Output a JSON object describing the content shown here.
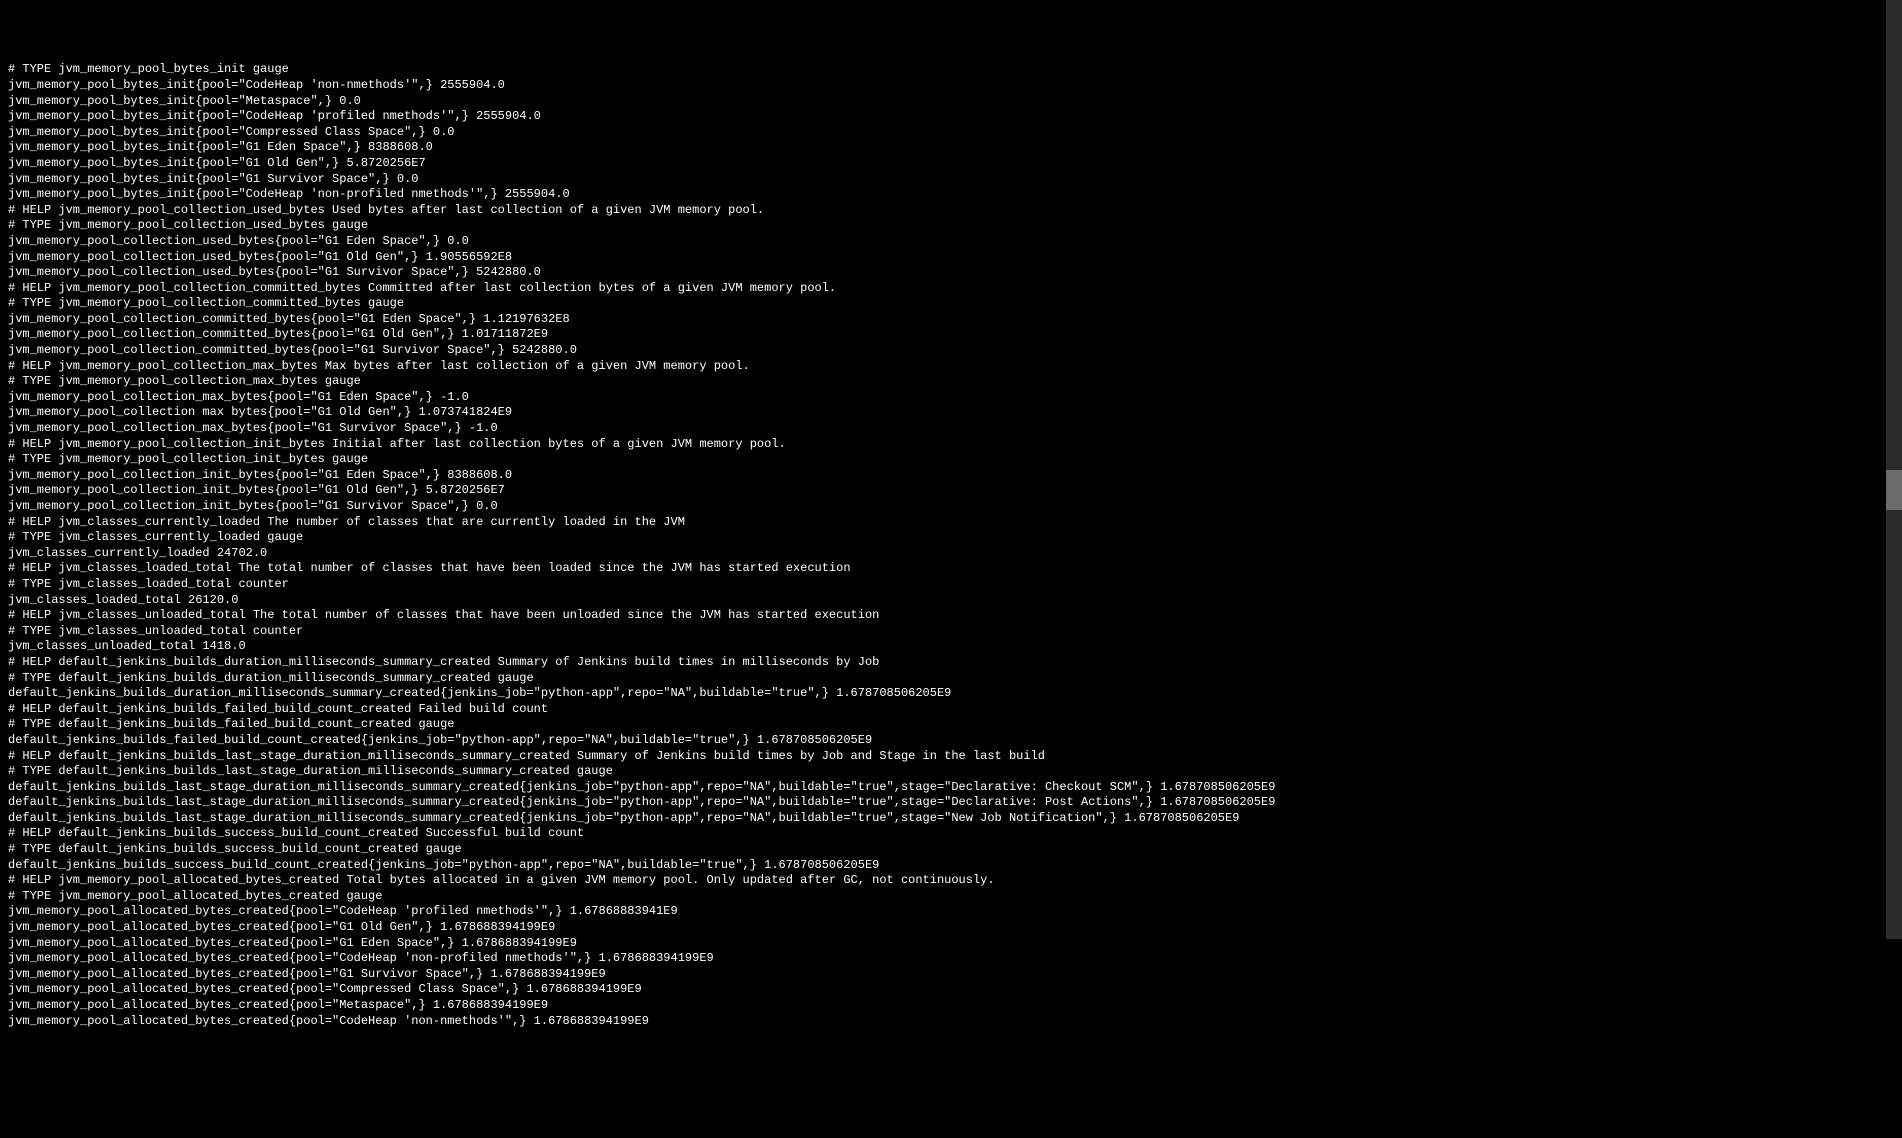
{
  "lines": [
    "# TYPE jvm_memory_pool_bytes_init gauge",
    "jvm_memory_pool_bytes_init{pool=\"CodeHeap 'non-nmethods'\",} 2555904.0",
    "jvm_memory_pool_bytes_init{pool=\"Metaspace\",} 0.0",
    "jvm_memory_pool_bytes_init{pool=\"CodeHeap 'profiled nmethods'\",} 2555904.0",
    "jvm_memory_pool_bytes_init{pool=\"Compressed Class Space\",} 0.0",
    "jvm_memory_pool_bytes_init{pool=\"G1 Eden Space\",} 8388608.0",
    "jvm_memory_pool_bytes_init{pool=\"G1 Old Gen\",} 5.8720256E7",
    "jvm_memory_pool_bytes_init{pool=\"G1 Survivor Space\",} 0.0",
    "jvm_memory_pool_bytes_init{pool=\"CodeHeap 'non-profiled nmethods'\",} 2555904.0",
    "# HELP jvm_memory_pool_collection_used_bytes Used bytes after last collection of a given JVM memory pool.",
    "# TYPE jvm_memory_pool_collection_used_bytes gauge",
    "jvm_memory_pool_collection_used_bytes{pool=\"G1 Eden Space\",} 0.0",
    "jvm_memory_pool_collection_used_bytes{pool=\"G1 Old Gen\",} 1.90556592E8",
    "jvm_memory_pool_collection_used_bytes{pool=\"G1 Survivor Space\",} 5242880.0",
    "# HELP jvm_memory_pool_collection_committed_bytes Committed after last collection bytes of a given JVM memory pool.",
    "# TYPE jvm_memory_pool_collection_committed_bytes gauge",
    "jvm_memory_pool_collection_committed_bytes{pool=\"G1 Eden Space\",} 1.12197632E8",
    "jvm_memory_pool_collection_committed_bytes{pool=\"G1 Old Gen\",} 1.01711872E9",
    "jvm_memory_pool_collection_committed_bytes{pool=\"G1 Survivor Space\",} 5242880.0",
    "# HELP jvm_memory_pool_collection_max_bytes Max bytes after last collection of a given JVM memory pool.",
    "# TYPE jvm_memory_pool_collection_max_bytes gauge",
    "jvm_memory_pool_collection_max_bytes{pool=\"G1 Eden Space\",} -1.0",
    "jvm_memory_pool_collection max bytes{pool=\"G1 Old Gen\",} 1.073741824E9",
    "jvm_memory_pool_collection_max_bytes{pool=\"G1 Survivor Space\",} -1.0",
    "# HELP jvm_memory_pool_collection_init_bytes Initial after last collection bytes of a given JVM memory pool.",
    "# TYPE jvm_memory_pool_collection_init_bytes gauge",
    "jvm_memory_pool_collection_init_bytes{pool=\"G1 Eden Space\",} 8388608.0",
    "jvm_memory_pool_collection_init_bytes{pool=\"G1 Old Gen\",} 5.8720256E7",
    "jvm_memory_pool_collection_init_bytes{pool=\"G1 Survivor Space\",} 0.0",
    "# HELP jvm_classes_currently_loaded The number of classes that are currently loaded in the JVM",
    "# TYPE jvm_classes_currently_loaded gauge",
    "jvm_classes_currently_loaded 24702.0",
    "# HELP jvm_classes_loaded_total The total number of classes that have been loaded since the JVM has started execution",
    "# TYPE jvm_classes_loaded_total counter",
    "jvm_classes_loaded_total 26120.0",
    "# HELP jvm_classes_unloaded_total The total number of classes that have been unloaded since the JVM has started execution",
    "# TYPE jvm_classes_unloaded_total counter",
    "jvm_classes_unloaded_total 1418.0",
    "# HELP default_jenkins_builds_duration_milliseconds_summary_created Summary of Jenkins build times in milliseconds by Job",
    "# TYPE default_jenkins_builds_duration_milliseconds_summary_created gauge",
    "default_jenkins_builds_duration_milliseconds_summary_created{jenkins_job=\"python-app\",repo=\"NA\",buildable=\"true\",} 1.678708506205E9",
    "# HELP default_jenkins_builds_failed_build_count_created Failed build count",
    "# TYPE default_jenkins_builds_failed_build_count_created gauge",
    "default_jenkins_builds_failed_build_count_created{jenkins_job=\"python-app\",repo=\"NA\",buildable=\"true\",} 1.678708506205E9",
    "# HELP default_jenkins_builds_last_stage_duration_milliseconds_summary_created Summary of Jenkins build times by Job and Stage in the last build",
    "# TYPE default_jenkins_builds_last_stage_duration_milliseconds_summary_created gauge",
    "default_jenkins_builds_last_stage_duration_milliseconds_summary_created{jenkins_job=\"python-app\",repo=\"NA\",buildable=\"true\",stage=\"Declarative: Checkout SCM\",} 1.678708506205E9",
    "default_jenkins_builds_last_stage_duration_milliseconds_summary_created{jenkins_job=\"python-app\",repo=\"NA\",buildable=\"true\",stage=\"Declarative: Post Actions\",} 1.678708506205E9",
    "default_jenkins_builds_last_stage_duration_milliseconds_summary_created{jenkins_job=\"python-app\",repo=\"NA\",buildable=\"true\",stage=\"New Job Notification\",} 1.678708506205E9",
    "# HELP default_jenkins_builds_success_build_count_created Successful build count",
    "# TYPE default_jenkins_builds_success_build_count_created gauge",
    "default_jenkins_builds_success_build_count_created{jenkins_job=\"python-app\",repo=\"NA\",buildable=\"true\",} 1.678708506205E9",
    "# HELP jvm_memory_pool_allocated_bytes_created Total bytes allocated in a given JVM memory pool. Only updated after GC, not continuously.",
    "# TYPE jvm_memory_pool_allocated_bytes_created gauge",
    "jvm_memory_pool_allocated_bytes_created{pool=\"CodeHeap 'profiled nmethods'\",} 1.67868883941E9",
    "jvm_memory_pool_allocated_bytes_created{pool=\"G1 Old Gen\",} 1.678688394199E9",
    "jvm_memory_pool_allocated_bytes_created{pool=\"G1 Eden Space\",} 1.678688394199E9",
    "jvm_memory_pool_allocated_bytes_created{pool=\"CodeHeap 'non-profiled nmethods'\",} 1.678688394199E9",
    "jvm_memory_pool_allocated_bytes_created{pool=\"G1 Survivor Space\",} 1.678688394199E9",
    "jvm_memory_pool_allocated_bytes_created{pool=\"Compressed Class Space\",} 1.678688394199E9",
    "jvm_memory_pool_allocated_bytes_created{pool=\"Metaspace\",} 1.678688394199E9",
    "jvm_memory_pool_allocated_bytes_created{pool=\"CodeHeap 'non-nmethods'\",} 1.678688394199E9"
  ]
}
